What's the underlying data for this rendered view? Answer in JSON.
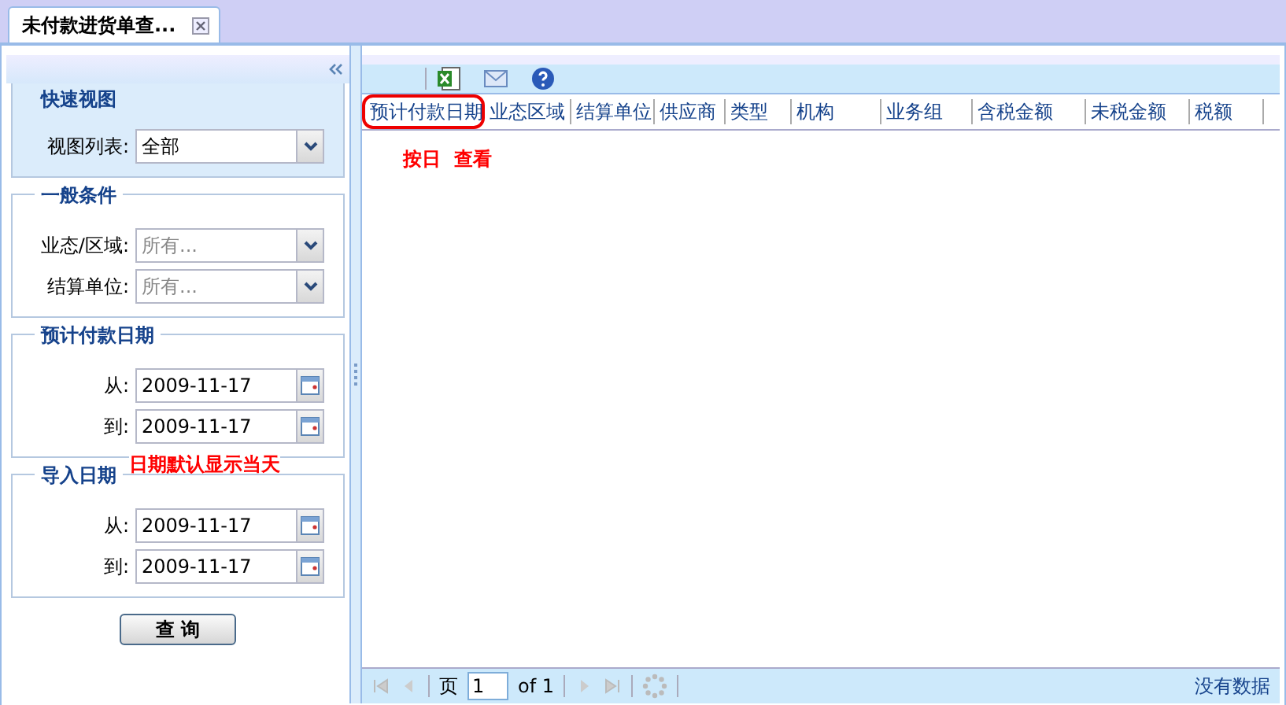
{
  "tabs": [
    {
      "label": "未付款进货单查...",
      "selected": true
    }
  ],
  "sidebar": {
    "sections": [
      {
        "title": "快速视图",
        "fields": [
          {
            "label": "视图列表:",
            "kind": "select",
            "value": "全部"
          }
        ]
      },
      {
        "title": "一般条件",
        "fields": [
          {
            "label": "业态/区域:",
            "kind": "select",
            "placeholder": "所有..."
          },
          {
            "label": "结算单位:",
            "kind": "select",
            "placeholder": "所有..."
          }
        ]
      },
      {
        "title": "预计付款日期",
        "fields": [
          {
            "label": "从:",
            "kind": "date",
            "value": "2009-11-17"
          },
          {
            "label": "到:",
            "kind": "date",
            "value": "2009-11-17"
          }
        ],
        "note": "日期默认显示当天"
      },
      {
        "title": "导入日期",
        "fields": [
          {
            "label": "从:",
            "kind": "date",
            "value": "2009-11-17"
          },
          {
            "label": "到:",
            "kind": "date",
            "value": "2009-11-17"
          }
        ]
      }
    ],
    "button": "查 询"
  },
  "table": {
    "columns": [
      {
        "label": "预计付款日期",
        "highlighted": true
      },
      {
        "label": "业态区域",
        "highlighted": false
      },
      {
        "label": "结算单位",
        "highlighted": false
      },
      {
        "label": "供应商",
        "highlighted": false
      },
      {
        "label": "类型",
        "highlighted": false
      },
      {
        "label": "机构",
        "highlighted": false
      },
      {
        "label": "业务组",
        "highlighted": false
      },
      {
        "label": "含税金额",
        "highlighted": false
      },
      {
        "label": "未税金额",
        "highlighted": false
      },
      {
        "label": "税额",
        "highlighted": false
      }
    ],
    "note": "按日  查看"
  },
  "pager": {
    "page_label": "页",
    "page": "1",
    "of": "of 1",
    "status": "没有数据"
  }
}
